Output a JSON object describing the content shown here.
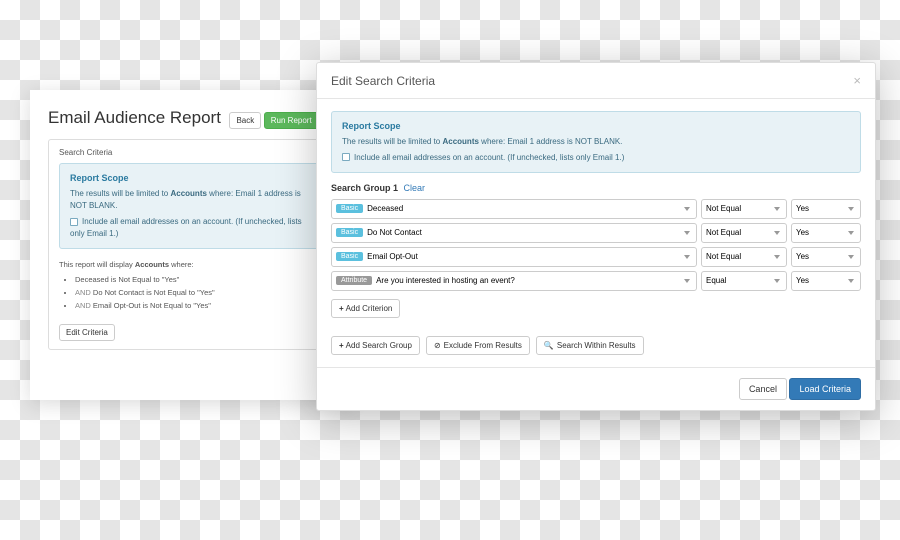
{
  "back": {
    "title": "Email Audience Report",
    "back_btn": "Back",
    "run_btn": "Run Report",
    "search_criteria_heading": "Search Criteria",
    "scope": {
      "title": "Report Scope",
      "line_a": "The results will be limited to ",
      "line_accounts": "Accounts",
      "line_b": " where: Email 1 address is NOT BLANK.",
      "checkbox_label": "Include all email addresses on an account. (If unchecked, lists only Email 1.)"
    },
    "summary_intro_a": "This report will display ",
    "summary_intro_bold": "Accounts",
    "summary_intro_b": " where:",
    "and_label": "AND",
    "bullet1": "Deceased is Not Equal to \"Yes\"",
    "bullet2": " Do Not Contact is Not Equal to \"Yes\"",
    "bullet3": " Email Opt-Out is Not Equal to \"Yes\"",
    "edit_criteria_btn": "Edit Criteria"
  },
  "modal": {
    "title": "Edit Search Criteria",
    "scope": {
      "title": "Report Scope",
      "line_a": "The results will be limited to ",
      "line_accounts": "Accounts",
      "line_b": " where: Email 1 address is NOT BLANK.",
      "checkbox_label": "Include all email addresses on an account. (If unchecked, lists only Email 1.)"
    },
    "group1_label": "Search Group 1",
    "clear_link": "Clear",
    "tags": {
      "basic": "Basic",
      "attribute": "Attribute"
    },
    "rows": [
      {
        "tag": "basic",
        "field": "Deceased",
        "op": "Not Equal",
        "val": "Yes"
      },
      {
        "tag": "basic",
        "field": "Do Not Contact",
        "op": "Not Equal",
        "val": "Yes"
      },
      {
        "tag": "basic",
        "field": "Email Opt-Out",
        "op": "Not Equal",
        "val": "Yes"
      },
      {
        "tag": "attribute",
        "field": "Are you interested in hosting an event?",
        "op": "Equal",
        "val": "Yes"
      }
    ],
    "add_criterion": "Add Criterion",
    "add_group": "Add Search Group",
    "exclude": "Exclude From Results",
    "within": "Search Within Results",
    "cancel": "Cancel",
    "load": "Load Criteria"
  }
}
